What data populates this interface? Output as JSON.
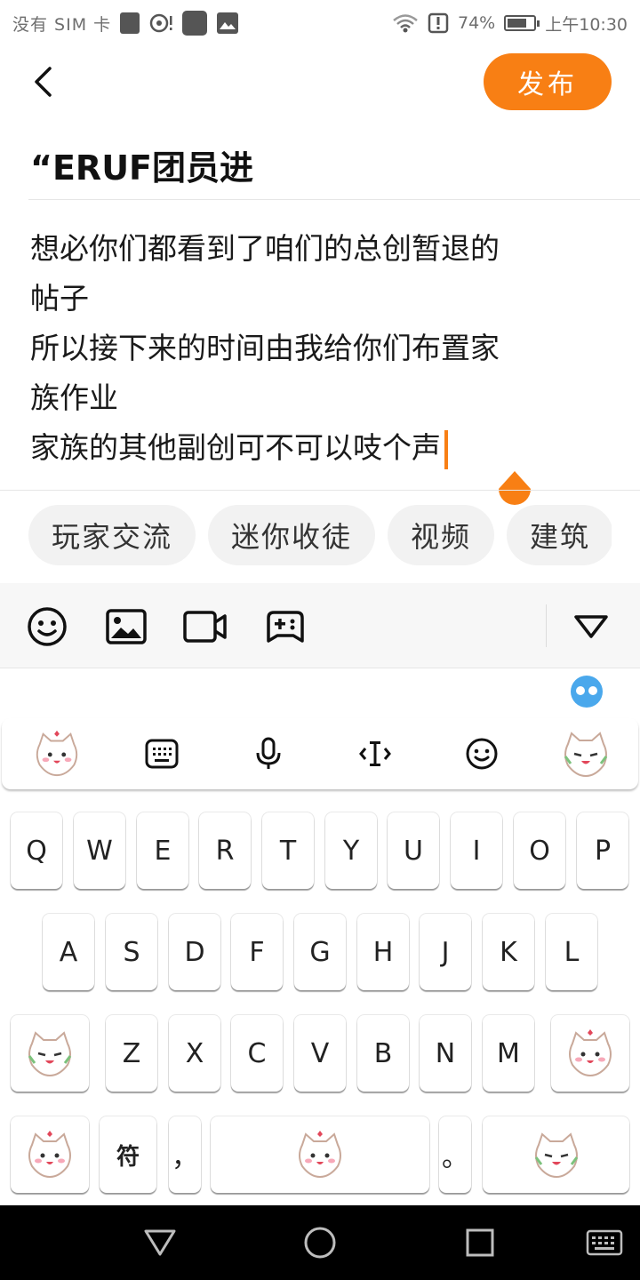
{
  "status_bar": {
    "carrier": "没有 SIM 卡",
    "battery": "74%",
    "battery_level": 0.74,
    "time": "上午10:30"
  },
  "header": {
    "back_icon": "back-arrow-icon",
    "publish_label": "发布"
  },
  "post": {
    "title": "“ERUF团员进",
    "body_lines": [
      "想必你们都看到了咱们的总创暂退的",
      "帖子",
      "所以接下来的时间由我给你们布置家",
      "族作业",
      "家族的其他副创可不可以吱个声"
    ]
  },
  "tags": [
    "玩家交流",
    "迷你收徒",
    "视频",
    "建筑"
  ],
  "toolbar": {
    "icons": [
      "emoji-icon",
      "image-icon",
      "video-icon",
      "game-icon",
      "collapse-icon"
    ]
  },
  "keyboard": {
    "toolbar_icons": [
      "sticker-icon",
      "keyboard-icon",
      "mic-icon",
      "cursor-icon",
      "emoji-icon",
      "sticker-icon"
    ],
    "rows": [
      [
        "Q",
        "W",
        "E",
        "R",
        "T",
        "Y",
        "U",
        "I",
        "O",
        "P"
      ],
      [
        "A",
        "S",
        "D",
        "F",
        "G",
        "H",
        "J",
        "K",
        "L"
      ],
      [
        "Z",
        "X",
        "C",
        "V",
        "B",
        "N",
        "M"
      ]
    ],
    "symbol_key": "符",
    "comma_key": "，",
    "period_key": "。",
    "accent": "#f87f14"
  },
  "nav_bar": {
    "icons": [
      "back-triangle-icon",
      "home-circle-icon",
      "recents-square-icon",
      "keyboard-toggle-icon"
    ]
  }
}
